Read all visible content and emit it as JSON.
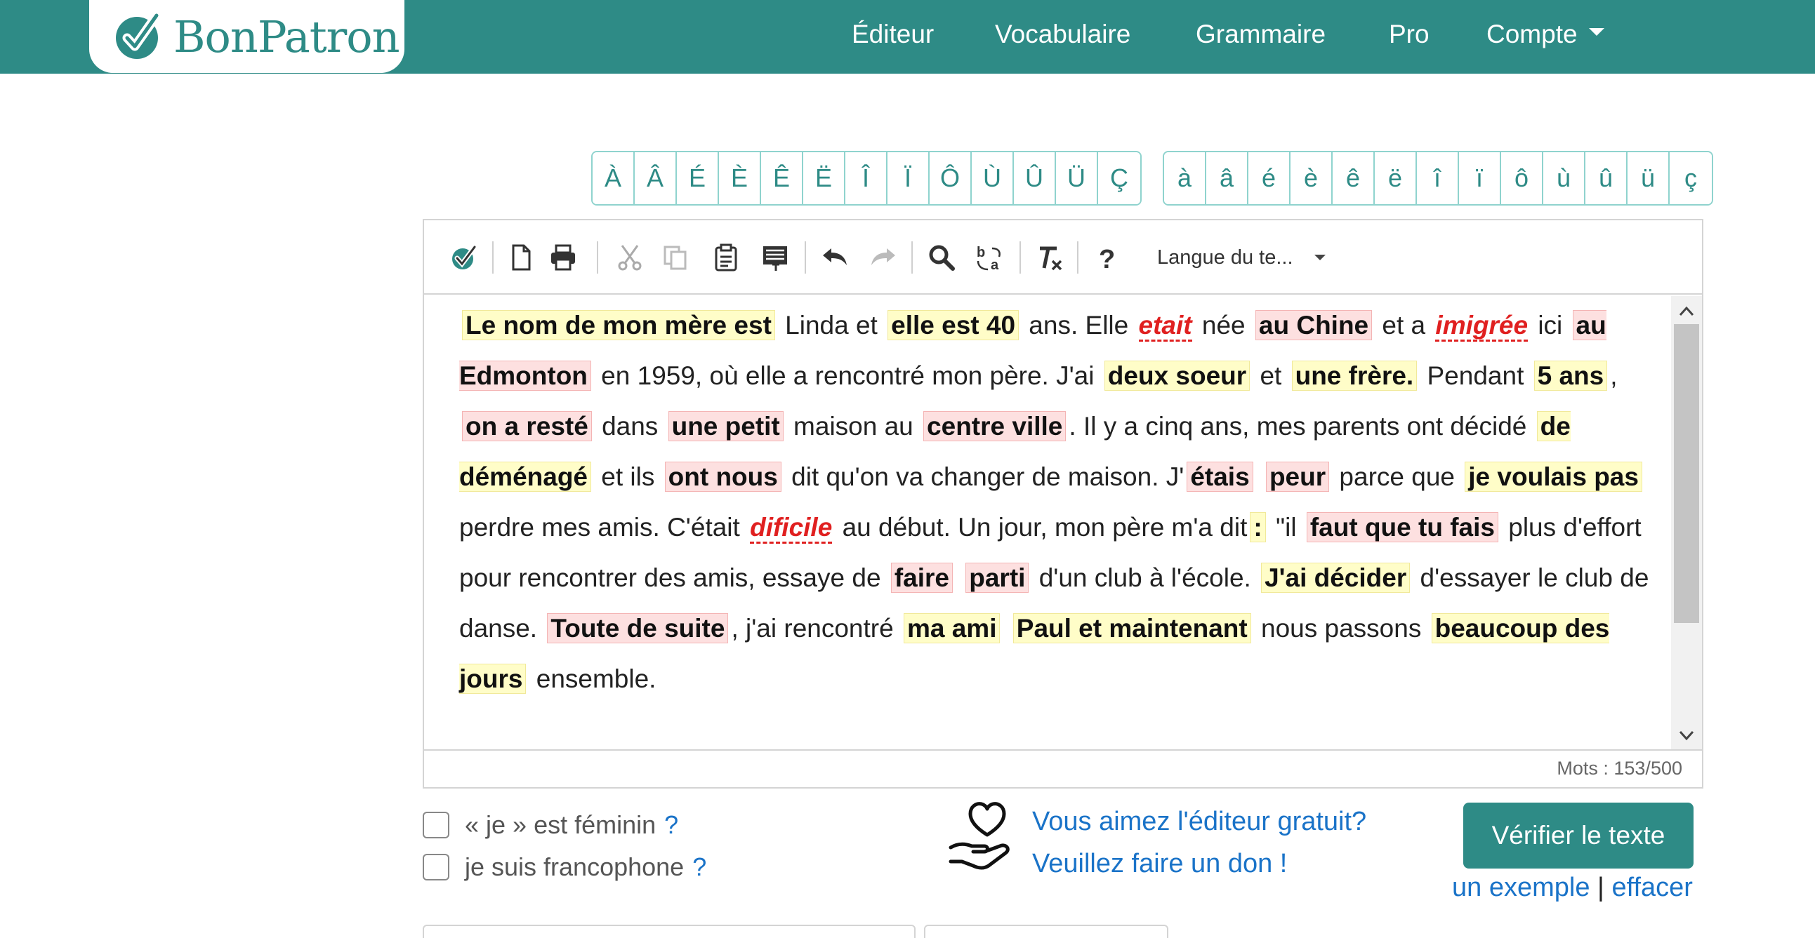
{
  "brand": {
    "name": "BonPatron",
    "color": "#2e8b86"
  },
  "nav": {
    "editor": "Éditeur",
    "vocabulary": "Vocabulaire",
    "grammar": "Grammaire",
    "pro": "Pro",
    "account": "Compte"
  },
  "accents": {
    "upper": [
      "À",
      "Â",
      "É",
      "È",
      "Ê",
      "Ë",
      "Î",
      "Ï",
      "Ô",
      "Ù",
      "Û",
      "Ü",
      "Ç"
    ],
    "lower": [
      "à",
      "â",
      "é",
      "è",
      "ê",
      "ë",
      "î",
      "ï",
      "ô",
      "ù",
      "û",
      "ü",
      "ç"
    ]
  },
  "toolbar": {
    "icons": [
      "check-icon",
      "new-document-icon",
      "print-icon",
      "cut-icon",
      "copy-icon",
      "paste-icon",
      "paste-text-icon",
      "undo-icon",
      "redo-icon",
      "find-icon",
      "replace-icon",
      "remove-format-icon",
      "help-icon"
    ],
    "language_select": "Langue du te..."
  },
  "text_segments": [
    {
      "t": "Le nom de mon mère est",
      "c": "y"
    },
    {
      "t": " Linda et "
    },
    {
      "t": "elle est 40",
      "c": "y"
    },
    {
      "t": " ans. Elle "
    },
    {
      "t": "etait",
      "c": "s"
    },
    {
      "t": " née "
    },
    {
      "t": "au Chine",
      "c": "r"
    },
    {
      "t": " et a "
    },
    {
      "t": "imigrée",
      "c": "s"
    },
    {
      "t": " ici "
    },
    {
      "t": "au Edmonton",
      "c": "r"
    },
    {
      "t": " en 1959, où elle a rencontré mon père. J'ai "
    },
    {
      "t": "deux soeur",
      "c": "y"
    },
    {
      "t": " et "
    },
    {
      "t": "une frère.",
      "c": "y"
    },
    {
      "t": " Pendant "
    },
    {
      "t": "5 ans",
      "c": "y"
    },
    {
      "t": ", "
    },
    {
      "t": "on a resté",
      "c": "r"
    },
    {
      "t": " dans "
    },
    {
      "t": "une petit",
      "c": "r"
    },
    {
      "t": " maison au "
    },
    {
      "t": "centre ville",
      "c": "r"
    },
    {
      "t": ". Il y a cinq ans, mes"
    },
    {
      "t": " parents ont décidé "
    },
    {
      "t": "de déménagé",
      "c": "y"
    },
    {
      "t": " et ils "
    },
    {
      "t": "ont nous",
      "c": "r"
    },
    {
      "t": " dit qu'on va changer de maison. J'"
    },
    {
      "t": "étais",
      "c": "r"
    },
    {
      "t": " "
    },
    {
      "t": "peur",
      "c": "r"
    },
    {
      "t": " parce que "
    },
    {
      "t": "je voulais pas",
      "c": "y"
    },
    {
      "t": " perdre mes amis. C'était "
    },
    {
      "t": "dificile",
      "c": "s"
    },
    {
      "t": " au début. Un jour, mon"
    },
    {
      "t": " père m'a dit"
    },
    {
      "t": ":",
      "c": "y"
    },
    {
      "t": " \"il "
    },
    {
      "t": "faut que tu fais",
      "c": "r"
    },
    {
      "t": " plus d'effort pour rencontrer des amis, essaye de "
    },
    {
      "t": "faire",
      "c": "r"
    },
    {
      "t": " "
    },
    {
      "t": "parti",
      "c": "r"
    },
    {
      "t": " d'un club à l'école. "
    },
    {
      "t": "J'ai décider",
      "c": "y"
    },
    {
      "t": " d'essayer le club de danse. "
    },
    {
      "t": "Toute de suite",
      "c": "r"
    },
    {
      "t": ", j'ai"
    },
    {
      "t": " rencontré "
    },
    {
      "t": "ma ami",
      "c": "y"
    },
    {
      "t": " "
    },
    {
      "t": "Paul et maintenant",
      "c": "y"
    },
    {
      "t": " nous passons "
    },
    {
      "t": "beaucoup des jours",
      "c": "y"
    },
    {
      "t": " ensemble."
    }
  ],
  "word_count": "Mots : 153/500",
  "options": {
    "feminine": "« je » est féminin",
    "francophone": "je suis francophone",
    "help_mark": "?"
  },
  "donate": {
    "line1": "Vous aimez l'éditeur gratuit?",
    "line2": "Veuillez faire un don !"
  },
  "actions": {
    "verify": "Vérifier le texte",
    "example": "un exemple",
    "separator": "|",
    "clear": "effacer"
  },
  "colors": {
    "teal": "#2e8b86",
    "link": "#1a73c8",
    "highlight_yellow": "#fffdc8",
    "highlight_red": "#fde0e0",
    "spelling_red": "#e02020"
  }
}
